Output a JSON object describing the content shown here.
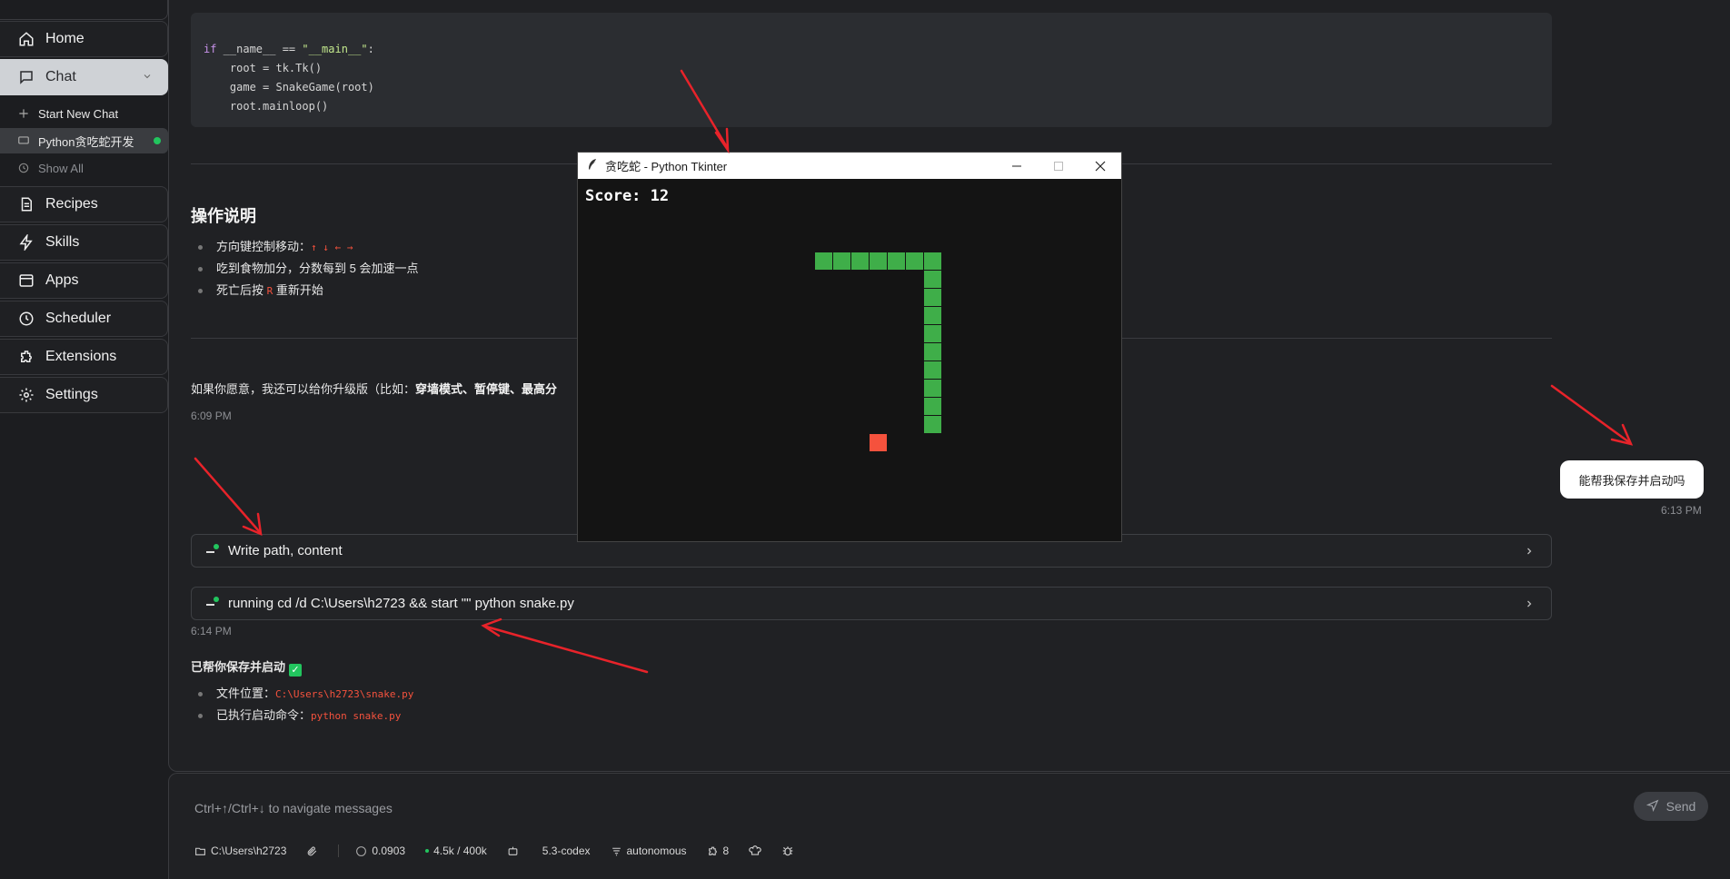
{
  "sidebar": {
    "items": [
      {
        "label": "Home",
        "icon": "home-icon"
      },
      {
        "label": "Chat",
        "icon": "chat-icon"
      },
      {
        "label": "Recipes",
        "icon": "recipes-icon"
      },
      {
        "label": "Skills",
        "icon": "skills-icon"
      },
      {
        "label": "Apps",
        "icon": "apps-icon"
      },
      {
        "label": "Scheduler",
        "icon": "clock-icon"
      },
      {
        "label": "Extensions",
        "icon": "puzzle-icon"
      },
      {
        "label": "Settings",
        "icon": "gear-icon"
      }
    ],
    "chat_sub": {
      "start_new": "Start New Chat",
      "current_session": "Python贪吃蛇开发",
      "show_all": "Show All"
    }
  },
  "code": {
    "lines": [
      {
        "kw": "if",
        "rest": " __name__ == ",
        "str": "\"__main__\"",
        "end": ":"
      },
      {
        "text": "    root = tk.Tk()"
      },
      {
        "text": "    game = SnakeGame(root)"
      },
      {
        "text": "    root.mainloop()"
      }
    ]
  },
  "instructions": {
    "title": "操作说明",
    "items": [
      {
        "text": "方向键控制移动：",
        "code": "↑ ↓ ← →",
        "tail": ""
      },
      {
        "text": "吃到食物加分，分数每到 5 会加速一点",
        "code": "",
        "tail": ""
      },
      {
        "text": "死亡后按 ",
        "code": "R",
        "tail": " 重新开始"
      }
    ]
  },
  "upgrade_text": {
    "prefix": "如果你愿意，我还可以给你升级版（比如：",
    "bold": "穿墙模式、暂停键、最高分"
  },
  "times": {
    "t1": "6:09 PM",
    "t2": "6:13 PM",
    "t3": "6:14 PM"
  },
  "user_message": "能帮我保存并启动吗",
  "tools": [
    {
      "label": "Write path, content"
    },
    {
      "label": "running cd /d C:\\Users\\h2723 && start \"\" python snake.py"
    }
  ],
  "result": {
    "title": "已帮你保存并启动",
    "check": "✓",
    "items": [
      {
        "label": "文件位置：",
        "code": "C:\\Users\\h2723\\snake.py"
      },
      {
        "label": "已执行启动命令：",
        "code": "python snake.py"
      }
    ]
  },
  "tk_window": {
    "title": "贪吃蛇 - Python Tkinter",
    "score_text": "Score: 12",
    "board_bg": "#141414",
    "snake_color": "#3fae49",
    "food_color": "#f5523d",
    "cell": 20,
    "snake_cells": [
      [
        13,
        4
      ],
      [
        14,
        4
      ],
      [
        15,
        4
      ],
      [
        16,
        4
      ],
      [
        17,
        4
      ],
      [
        18,
        4
      ],
      [
        19,
        4
      ],
      [
        19,
        5
      ],
      [
        19,
        6
      ],
      [
        19,
        7
      ],
      [
        19,
        8
      ],
      [
        19,
        9
      ],
      [
        19,
        10
      ],
      [
        19,
        11
      ],
      [
        19,
        12
      ],
      [
        19,
        13
      ]
    ],
    "food_cell": [
      16,
      14
    ]
  },
  "input": {
    "placeholder": "Ctrl+↑/Ctrl+↓ to navigate messages",
    "send_label": "Send"
  },
  "status": {
    "dir": "C:\\Users\\h2723",
    "cost": "0.0903",
    "tokens": "4.5k / 400k",
    "model": "5.3-codex",
    "mode": "autonomous",
    "extensions_count": "8"
  },
  "colors": {
    "accent_green": "#22c55e",
    "annotation_red": "#e8232a"
  }
}
